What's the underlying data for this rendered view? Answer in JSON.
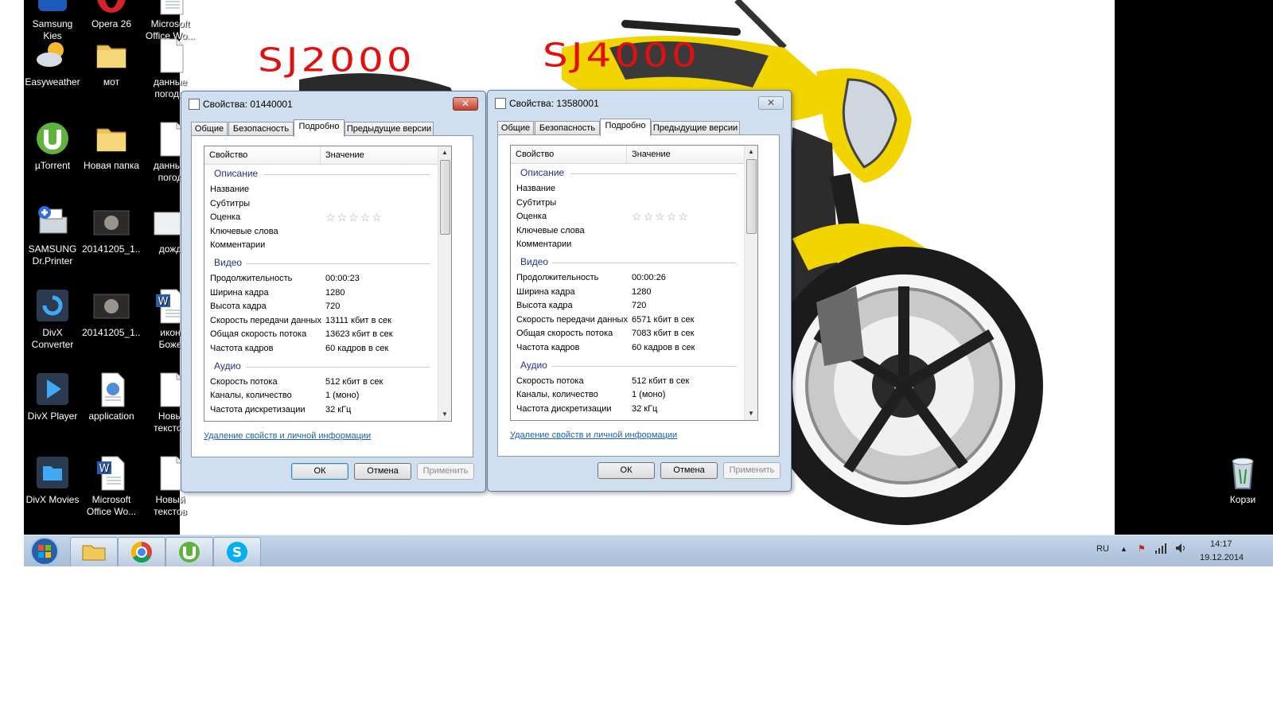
{
  "desktop": {
    "icons": [
      {
        "label": "Samsung\nKies",
        "icon": "samsung-kies-icon"
      },
      {
        "label": "Opera 26",
        "icon": "opera-icon"
      },
      {
        "label": "Microsoft\nOffice Wo...",
        "icon": "word-doc-icon"
      },
      {
        "label": "Easyweather",
        "icon": "weather-icon"
      },
      {
        "label": "мот",
        "icon": "folder-icon"
      },
      {
        "label": "данные\nпогоды",
        "icon": "text-file-icon"
      },
      {
        "label": "µTorrent",
        "icon": "utorrent-icon"
      },
      {
        "label": "Новая папка",
        "icon": "folder-icon"
      },
      {
        "label": "данные\nпогод",
        "icon": "text-file-icon"
      },
      {
        "label": "SAMSUNG\nDr.Printer",
        "icon": "printer-icon"
      },
      {
        "label": "20141205_1...",
        "icon": "video-thumbnail-icon"
      },
      {
        "label": "дожд",
        "icon": "image-file-icon"
      },
      {
        "label": "DivX\nConverter",
        "icon": "divx-converter-icon"
      },
      {
        "label": "20141205_1...",
        "icon": "video-thumbnail-icon"
      },
      {
        "label": "икон\nБоже",
        "icon": "word-doc-icon"
      },
      {
        "label": "DivX Player",
        "icon": "divx-player-icon"
      },
      {
        "label": "application",
        "icon": "application-icon"
      },
      {
        "label": "Новы\nтекстов",
        "icon": "text-file-icon"
      },
      {
        "label": "DivX Movies",
        "icon": "divx-movies-icon"
      },
      {
        "label": "Microsoft\nOffice Wo...",
        "icon": "word-doc-icon"
      },
      {
        "label": "Новый\nтекстов",
        "icon": "text-file-icon"
      }
    ],
    "recycle_bin": {
      "label": "Корзи",
      "icon": "recycle-bin-icon"
    },
    "annotations": [
      "SJ2000",
      "SJ4000"
    ],
    "colors": {
      "annotation": "#e01010",
      "motorcycle": "#f2d400",
      "desktop_dark": "#000000"
    }
  },
  "dialogs": [
    {
      "title": "Свойства: 01440001",
      "active": true,
      "tabs": [
        "Общие",
        "Безопасность",
        "Подробно",
        "Предыдущие версии"
      ],
      "active_tab": 2,
      "columns": {
        "property": "Свойство",
        "value": "Значение"
      },
      "groups": {
        "description": "Описание",
        "video": "Видео",
        "audio": "Аудио"
      },
      "description_rows": [
        {
          "k": "Название",
          "v": ""
        },
        {
          "k": "Субтитры",
          "v": ""
        },
        {
          "k": "Оценка",
          "v": ""
        },
        {
          "k": "Ключевые слова",
          "v": ""
        },
        {
          "k": "Комментарии",
          "v": ""
        }
      ],
      "rating_stars": 0,
      "video_rows": [
        {
          "k": "Продолжительность",
          "v": "00:00:23"
        },
        {
          "k": "Ширина кадра",
          "v": "1280"
        },
        {
          "k": "Высота кадра",
          "v": "720"
        },
        {
          "k": "Скорость передачи данных",
          "v": "13111 кбит в сек"
        },
        {
          "k": "Общая скорость потока",
          "v": "13623 кбит в сек"
        },
        {
          "k": "Частота кадров",
          "v": "60 кадров в сек"
        }
      ],
      "audio_rows": [
        {
          "k": "Скорость потока",
          "v": "512 кбит в сек"
        },
        {
          "k": "Каналы, количество",
          "v": "1 (моно)"
        },
        {
          "k": "Частота дискретизации",
          "v": "32 кГц"
        }
      ],
      "remove_link": "Удаление свойств и личной информации",
      "buttons": {
        "ok": "ОК",
        "cancel": "Отмена",
        "apply": "Применить"
      },
      "close": "✕"
    },
    {
      "title": "Свойства: 13580001",
      "active": false,
      "tabs": [
        "Общие",
        "Безопасность",
        "Подробно",
        "Предыдущие версии"
      ],
      "active_tab": 2,
      "columns": {
        "property": "Свойство",
        "value": "Значение"
      },
      "groups": {
        "description": "Описание",
        "video": "Видео",
        "audio": "Аудио"
      },
      "description_rows": [
        {
          "k": "Название",
          "v": ""
        },
        {
          "k": "Субтитры",
          "v": ""
        },
        {
          "k": "Оценка",
          "v": ""
        },
        {
          "k": "Ключевые слова",
          "v": ""
        },
        {
          "k": "Комментарии",
          "v": ""
        }
      ],
      "rating_stars": 0,
      "video_rows": [
        {
          "k": "Продолжительность",
          "v": "00:00:26"
        },
        {
          "k": "Ширина кадра",
          "v": "1280"
        },
        {
          "k": "Высота кадра",
          "v": "720"
        },
        {
          "k": "Скорость передачи данных",
          "v": "6571 кбит в сек"
        },
        {
          "k": "Общая скорость потока",
          "v": "7083 кбит в сек"
        },
        {
          "k": "Частота кадров",
          "v": "60 кадров в сек"
        }
      ],
      "audio_rows": [
        {
          "k": "Скорость потока",
          "v": "512 кбит в сек"
        },
        {
          "k": "Каналы, количество",
          "v": "1 (моно)"
        },
        {
          "k": "Частота дискретизации",
          "v": "32 кГц"
        }
      ],
      "remove_link": "Удаление свойств и личной информации",
      "buttons": {
        "ok": "ОК",
        "cancel": "Отмена",
        "apply": "Применить"
      },
      "close": "✕"
    }
  ],
  "taskbar": {
    "pinned": [
      {
        "name": "start-button",
        "icon": "windows-logo-icon"
      },
      {
        "name": "taskbar-explorer",
        "icon": "folder-icon"
      },
      {
        "name": "taskbar-chrome",
        "icon": "chrome-icon"
      },
      {
        "name": "taskbar-utorrent",
        "icon": "utorrent-icon"
      },
      {
        "name": "taskbar-skype",
        "icon": "skype-icon"
      }
    ],
    "language": "RU",
    "time": "14:17",
    "date": "19.12.2014"
  }
}
